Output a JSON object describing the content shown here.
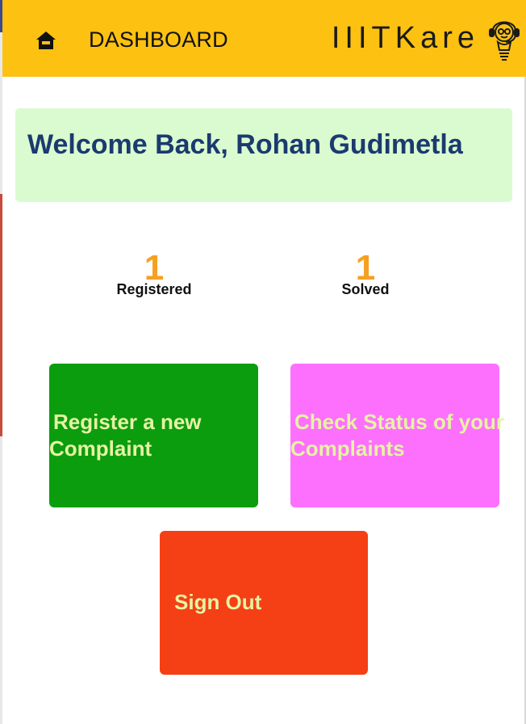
{
  "header": {
    "title": "DASHBOARD",
    "brand": "IIITKare",
    "color": "#fdc112",
    "home_icon": "home-icon",
    "brand_icon": "helpdesk-agent-icon"
  },
  "welcome": {
    "message": "Welcome Back, Rohan Gudimetla",
    "bg_color": "#dafbd0",
    "text_color": "#1b3a6e"
  },
  "stats": {
    "registered": {
      "count": "1",
      "label": "Registered"
    },
    "solved": {
      "count": "1",
      "label": "Solved"
    },
    "count_color": "#f6a021"
  },
  "actions": {
    "register": {
      "line1": "Register a new",
      "line2": "Complaint",
      "color": "#0b9d0e"
    },
    "status": {
      "line1": "Check Status of your",
      "line2": "Complaints",
      "color": "#fd70fd"
    },
    "signout": {
      "label": "Sign Out",
      "color": "#f53f14"
    }
  }
}
